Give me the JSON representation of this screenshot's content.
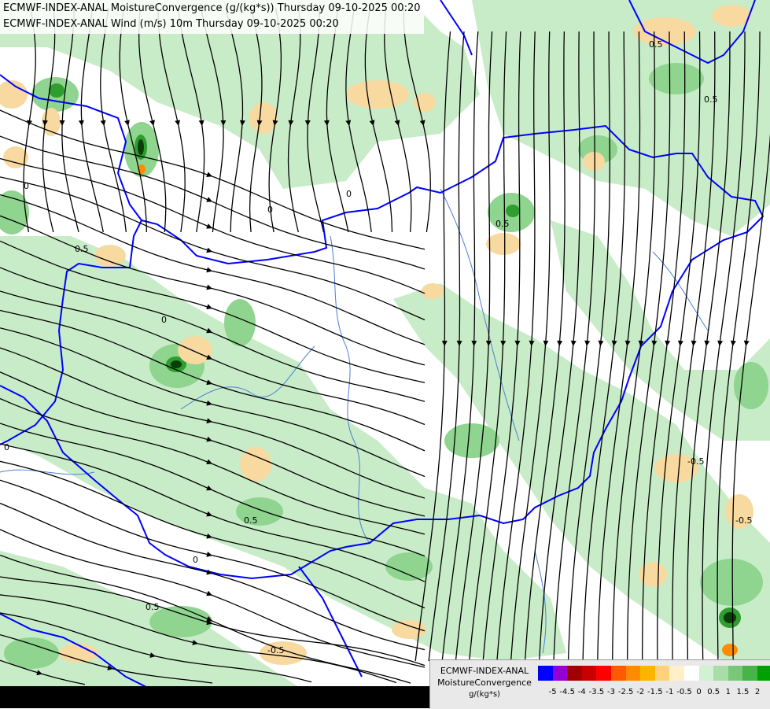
{
  "header": {
    "line1": "ECMWF-INDEX-ANAL MoistureConvergence (g/(kg*s)) Thursday 09-10-2025 00:20",
    "line2": "ECMWF-INDEX-ANAL Wind (m/s) 10m Thursday 09-10-2025 00:20"
  },
  "legend": {
    "title_line1": "ECMWF-INDEX-ANAL",
    "title_line2": "MoistureConvergence",
    "unit": "g/(kg*s)",
    "colors": [
      "#0000ff",
      "#9400d3",
      "#a00000",
      "#c80000",
      "#ff0000",
      "#ff5a00",
      "#ff8c00",
      "#ffb400",
      "#ffd27a",
      "#fff0c8",
      "#ffffff",
      "#d2f0d2",
      "#a8dca8",
      "#78c878",
      "#46b446",
      "#00a000"
    ],
    "ticks": [
      "-5",
      "-4.5",
      "-4",
      "-3.5",
      "-3",
      "-2.5",
      "-2",
      "-1.5",
      "-1",
      "-0.5",
      "0",
      "0.5",
      "1",
      "1.5",
      "2"
    ]
  },
  "contour_labels": [
    "0",
    "0",
    "0",
    "0",
    "0",
    "0",
    "-0.5",
    "-0.5",
    "-0.5",
    "0.5",
    "0.5",
    "0.5",
    "0.5",
    "0.5",
    "0.5"
  ],
  "colors": {
    "border": "#0000ff",
    "river": "#4a7fd6",
    "streamline": "#000000",
    "green_light": "#c8ecc8",
    "green_mid": "#8fd48f",
    "green_dark": "#2e9e2e",
    "orange_light": "#f8d9a0"
  }
}
